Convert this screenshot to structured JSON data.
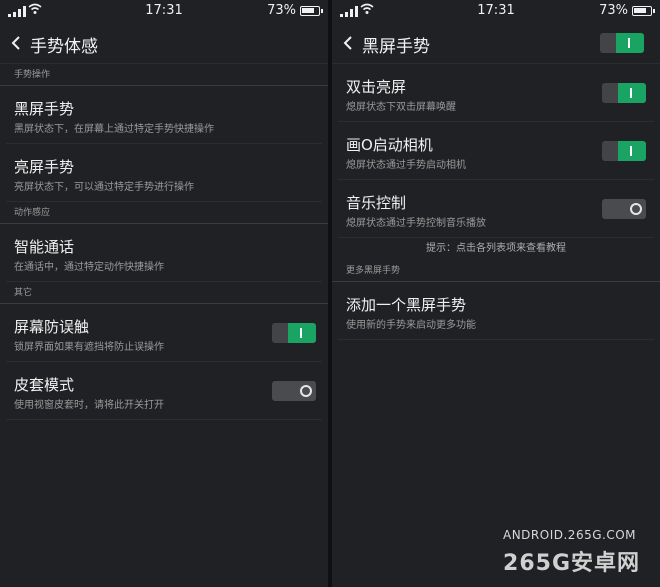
{
  "status": {
    "time": "17:31",
    "battery": "73%"
  },
  "left": {
    "title": "手势体感",
    "sections": [
      {
        "header": "手势操作",
        "items": [
          {
            "title": "黑屏手势",
            "subtitle": "黑屏状态下，在屏幕上通过特定手势快捷操作"
          },
          {
            "title": "亮屏手势",
            "subtitle": "亮屏状态下，可以通过特定手势进行操作"
          }
        ]
      },
      {
        "header": "动作感应",
        "items": [
          {
            "title": "智能通话",
            "subtitle": "在通话中，通过特定动作快捷操作"
          }
        ]
      },
      {
        "header": "其它",
        "items": [
          {
            "title": "屏幕防误触",
            "subtitle": "锁屏界面如果有遮挡将防止误操作",
            "toggle": "on"
          },
          {
            "title": "皮套模式",
            "subtitle": "使用视窗皮套时，请将此开关打开",
            "toggle": "off"
          }
        ]
      }
    ]
  },
  "right": {
    "title": "黑屏手势",
    "title_toggle": "on",
    "items": [
      {
        "title": "双击亮屏",
        "subtitle": "熄屏状态下双击屏幕唤醒",
        "toggle": "on"
      },
      {
        "title": "画O启动相机",
        "subtitle": "熄屏状态通过手势启动相机",
        "toggle": "on"
      },
      {
        "title": "音乐控制",
        "subtitle": "熄屏状态通过手势控制音乐播放",
        "toggle": "off"
      }
    ],
    "hint": "提示：点击各列表项来查看教程",
    "more_header": "更多黑屏手势",
    "more_items": [
      {
        "title": "添加一个黑屏手势",
        "subtitle": "使用新的手势来启动更多功能"
      }
    ]
  },
  "watermark": {
    "line1": "ANDROID.265G.COM",
    "line2": "265G安卓网"
  },
  "colors": {
    "accent_green": "#1aa463",
    "background": "#202124"
  }
}
